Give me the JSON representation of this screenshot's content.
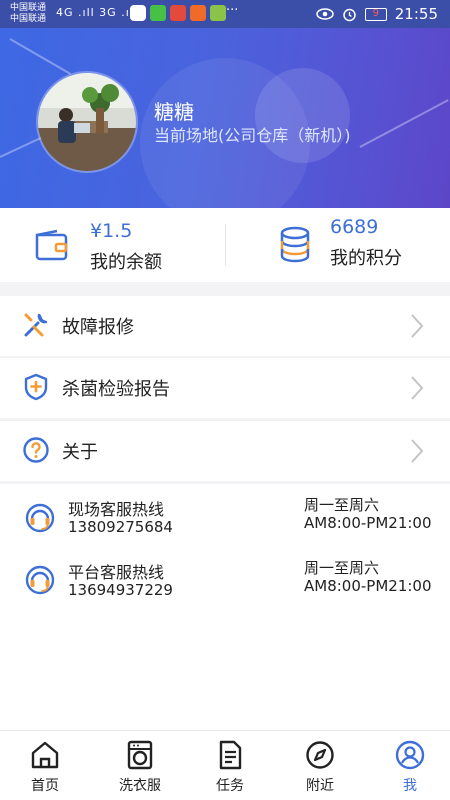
{
  "status_bar": {
    "carrier_1": "中国联通",
    "carrier_2": "中国联通",
    "signal_text": "4G .ıll 3G .ıll",
    "battery": "9",
    "time": "21:55"
  },
  "profile": {
    "username": "糖糖",
    "venue": "当前场地(公司仓库（新机）)"
  },
  "stats": {
    "balance_value": "¥1.5",
    "balance_label": "我的余额",
    "points_value": "6689",
    "points_label": "我的积分"
  },
  "menu": [
    {
      "label": "故障报修",
      "icon": "wrench-screwdriver-icon"
    },
    {
      "label": "杀菌检验报告",
      "icon": "shield-plus-icon"
    },
    {
      "label": "关于",
      "icon": "question-circle-icon"
    }
  ],
  "hotlines": [
    {
      "name": "现场客服热线",
      "phone": "13809275684",
      "days": "周一至周六",
      "hours": "AM8:00-PM21:00",
      "icon": "headset-icon"
    },
    {
      "name": "平台客服热线",
      "phone": "13694937229",
      "days": "周一至周六",
      "hours": "AM8:00-PM21:00",
      "icon": "headset-icon"
    }
  ],
  "tabbar": [
    {
      "label": "首页",
      "icon": "home-icon",
      "active": false
    },
    {
      "label": "洗衣服",
      "icon": "washing-machine-icon",
      "active": false
    },
    {
      "label": "任务",
      "icon": "document-icon",
      "active": false
    },
    {
      "label": "附近",
      "icon": "compass-icon",
      "active": false
    },
    {
      "label": "我",
      "icon": "user-circle-icon",
      "active": true
    }
  ],
  "colors": {
    "accent": "#3d6fd6",
    "header_start": "#3e68e4",
    "header_end": "#5c46c8",
    "icon_orange": "#f29c38"
  }
}
